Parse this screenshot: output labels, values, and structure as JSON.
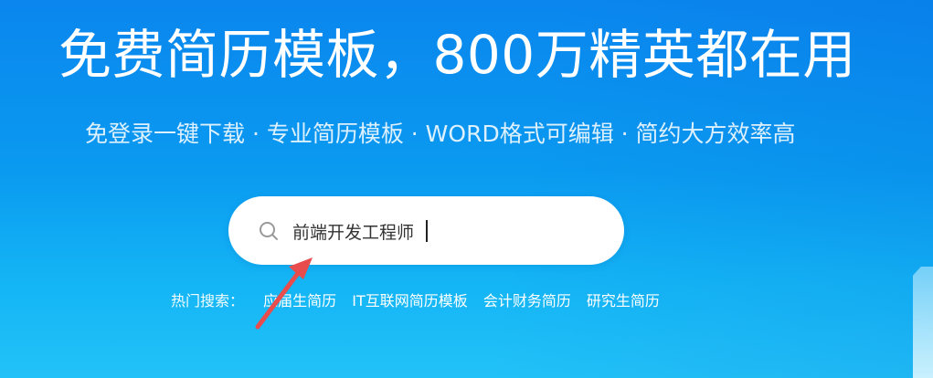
{
  "hero": {
    "headline": "免费简历模板，800万精英都在用",
    "subline": "免登录一键下载 · 专业简历模板 · WORD格式可编辑 · 简约大方效率高"
  },
  "search": {
    "value": "前端开发工程师",
    "icon": "search-icon"
  },
  "hot_search": {
    "label": "热门搜索：",
    "items": [
      "应届生简历",
      "IT互联网简历模板",
      "会计财务简历",
      "研究生简历"
    ]
  },
  "annotation": {
    "icon": "red-arrow-icon",
    "color": "#e84c4c"
  },
  "colors": {
    "background_top": "#0a86ee",
    "background_bottom": "#22c2f8",
    "search_box": "#ffffff"
  }
}
